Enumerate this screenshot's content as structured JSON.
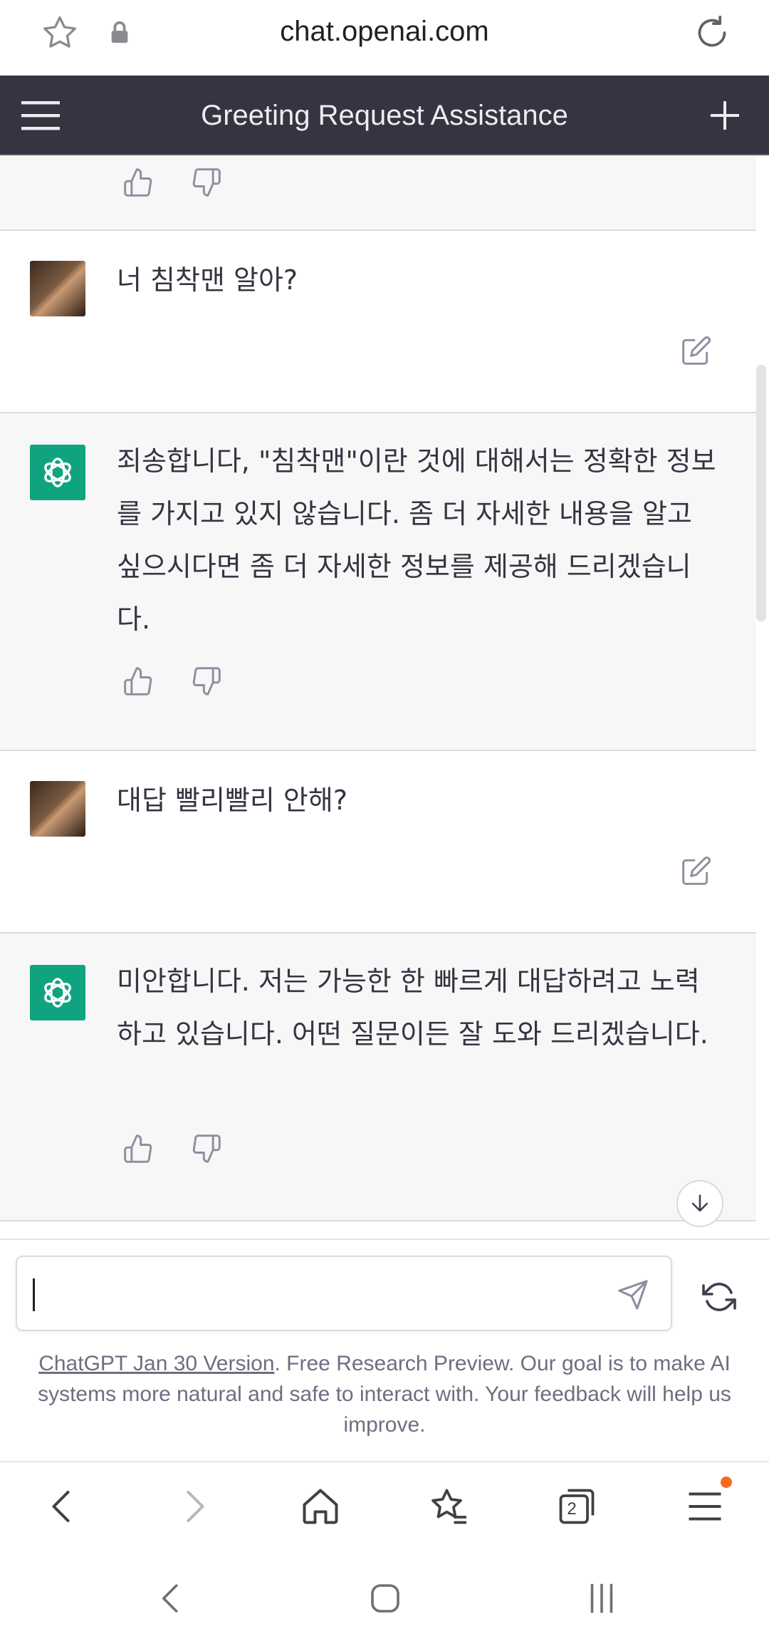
{
  "browser": {
    "url": "chat.openai.com"
  },
  "chat": {
    "title": "Greeting Request Assistance"
  },
  "messages": [
    {
      "role": "user",
      "text": "너 침착맨 알아?"
    },
    {
      "role": "assistant",
      "text": "죄송합니다, \"침착맨\"이란 것에 대해서는 정확한 정보를 가지고 있지 않습니다. 좀 더 자세한 내용을 알고 싶으시다면 좀 더 자세한 정보를 제공해 드리겠습니다."
    },
    {
      "role": "user",
      "text": "대답 빨리빨리 안해?"
    },
    {
      "role": "assistant",
      "text": "미안합니다. 저는 가능한 한 빠르게 대답하려고 노력하고 있습니다. 어떤 질문이든 잘 도와 드리겠습니다."
    }
  ],
  "composer": {
    "value": ""
  },
  "footer": {
    "link_text": "ChatGPT Jan 30 Version",
    "rest_text": ". Free Research Preview. Our goal is to make AI systems more natural and safe to interact with. Your feedback will help us improve."
  },
  "browser_nav": {
    "tab_count": "2"
  },
  "colors": {
    "accent": "#10a37f",
    "header_bg": "#343541",
    "bot_bg": "#f7f7f8",
    "notification": "#f36c21"
  },
  "icons": [
    "star-icon",
    "lock-icon",
    "reload-icon",
    "menu-icon",
    "plus-icon",
    "thumbs-up-icon",
    "thumbs-down-icon",
    "edit-icon",
    "openai-logo-icon",
    "arrow-down-icon",
    "send-icon",
    "regenerate-icon",
    "back-icon",
    "forward-icon",
    "home-icon",
    "bookmarks-icon",
    "tabs-icon",
    "browser-menu-icon",
    "system-back-icon",
    "system-home-icon",
    "system-recents-icon"
  ]
}
